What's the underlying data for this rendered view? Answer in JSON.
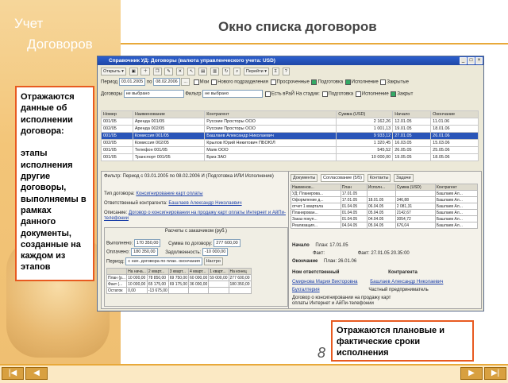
{
  "slide": {
    "logo_line1": "Учет",
    "logo_line2": "Договоров",
    "title": "Окно списка договоров",
    "page_number": "8",
    "callout_left": "Отражаются данные об исполнении договора:\n\nэтапы исполнения другие договоры, выполняемы в рамках данного документы, созданные на каждом из этапов",
    "callout_right": "Отражаются плановые и фактические сроки исполнения"
  },
  "app": {
    "window_title": "Справочник УД: Договоры (валюта управленческого учета: USD)",
    "toolbar": {
      "open": "Открыть",
      "go": "Перейти"
    },
    "filter_row": {
      "period_label": "Период",
      "period_from": "03.01.2005",
      "po": "по",
      "period_to": "08.02.2006",
      "mine": "Мои",
      "new_division": "Нового подразделения",
      "overdue": "Просроченные",
      "preparation": "Подготовка",
      "execution": "Исполнение",
      "closed": "Закрытые"
    },
    "filter_row2": {
      "contracts_label": "Договоры",
      "contracts_value": "не выбрано",
      "filter_label": "Фильтр",
      "filter_value": "не выбрано",
      "consider_vizy": "Есть вРаЙ",
      "stage_label": "На стадии:",
      "stage_prep": "Подготовка",
      "stage_exec": "Исполнение",
      "stage_closed": "Закрыт"
    },
    "table": {
      "headers": [
        "Номер",
        "Наименование",
        "Контрагент",
        "Сумма (USD)",
        "Начало",
        "Окончание"
      ],
      "rows": [
        [
          "001/05",
          "Аренда 001/05",
          "Русские Просторы ООО",
          "2 162,26",
          "12.01.05",
          "11.01.06"
        ],
        [
          "002/05",
          "Аренда 002/05",
          "Русские Просторы ООО",
          "1 001,13",
          "19.01.05",
          "18.01.06"
        ],
        [
          "001/05",
          "Комиссия 001/05",
          "Башлаев Александр Николаевич",
          "9 933,12",
          "27.01.05",
          "26.01.06"
        ],
        [
          "002/05",
          "Комиссия 002/05",
          "Крылов Юрий Никитович ПБОЮЛ",
          "1 320,45",
          "16.03.05",
          "15.03.06"
        ],
        [
          "001/05",
          "Телефон 001/05",
          "Маяк ООО",
          "545,52",
          "26.05.05",
          "25.05.06"
        ],
        [
          "001/05",
          "Транспорт 001/05",
          "Бриз ЗАО",
          "10 000,00",
          "19.05.05",
          "18.05.06"
        ]
      ],
      "selected_row": 2
    },
    "detail": {
      "filter_label": "Фильтр:",
      "filter_value": "Период с 03.01.2005 по 08.02.2006 И (Подготовка ИЛИ Исполнение)",
      "type_label": "Тип договора:",
      "type_value": "Консигнирование карт оплаты",
      "responsible_label": "Ответственный контрагента:",
      "responsible_value": "Башлаев Александр Николаевич",
      "description_label": "Описание:",
      "description_value": "Договор о консигнировании на продажу карт оплаты Интернет и АйПи-телефонии",
      "settlements_title": "Расчеты с заказчиком (руб.)",
      "done_label": "Выполнено:",
      "done_value": "170 350,00",
      "contract_sum_label": "Сумма по договору:",
      "contract_sum_value": "277 600,00",
      "paid_label": "Оплачено:",
      "paid_value": "180 350,00",
      "debt_label": "Задолженность:",
      "debt_value": "-10 000,00",
      "period_label": "Период:",
      "period_value": "с нач. договора по план. окончания",
      "settings": "Настро",
      "grid_headers": [
        "",
        "На нача...",
        "2 кварт...",
        "3 кварт...",
        "4 кварт...",
        "1 кварт...",
        "На конец"
      ],
      "grid_rows": [
        [
          "План (р...",
          "10 000,00",
          "78 850,00",
          "69 750,00",
          "60 000,00",
          "59 000,00",
          "277 600,00"
        ],
        [
          "Факт (...",
          "10 000,00",
          "65 175,00",
          "69 175,00",
          "36 000,00",
          "",
          "180 350,00"
        ],
        [
          "Остаток",
          "0,00",
          "-13 675,00",
          "",
          "",
          "",
          ""
        ]
      ]
    },
    "plan": {
      "tabs": [
        "Документы",
        "Согласование (5/5)",
        "Контакты",
        "Задачи"
      ],
      "headers": [
        "",
        "Наименов...",
        "План",
        "Исполн...",
        "Сумма (USD)",
        "Контрагент"
      ],
      "rows": [
        [
          "УД: Планирова...",
          "17.01.05",
          "",
          "",
          "Башлаев Ал..."
        ],
        [
          "Оформление д...",
          "17.01.05",
          "18.01.05",
          "346,88",
          "Башлаев Ал..."
        ],
        [
          "отчет 1 квартала",
          "01.04.05",
          "06.04.05",
          "2 081,31",
          "Башлаев Ал..."
        ],
        [
          "Планирован...",
          "01.04.05",
          "05.04.05",
          "2142,67",
          "Башлаев Ал..."
        ],
        [
          "Заказ покуп...",
          "01.04.05",
          "04.04.05",
          "3054,72",
          "Башлаев Ал..."
        ],
        [
          "Реализация...",
          "04.04.05",
          "05.04.05",
          "676,04",
          "Башлаев Ал..."
        ]
      ],
      "start_label": "Начало",
      "plan_label": "План:",
      "plan_start": "17.01.05",
      "fact_label": "Факт:",
      "end_label": "Окончание",
      "plan_end": "26.01.06",
      "fact_range": "Факт: 27.01.05 20.35:00",
      "responsible_head": "Ном ответственный",
      "counterparty_head": "Контрагента",
      "responsible_name": "Смирнова Мария Викторовна",
      "counterparty_name": "Башлаев Александр Николаевич",
      "dept": "Бухгалтерия",
      "entrepreneur": "Частный предприниматель",
      "contract_note": "Договор о консигнировании на продажу карт оплаты Интернет и АйПи-телефонии"
    }
  },
  "colors": {
    "accent": "#e8a93a",
    "callout_border": "#e85a20",
    "window_title": "#2c5fcf"
  }
}
